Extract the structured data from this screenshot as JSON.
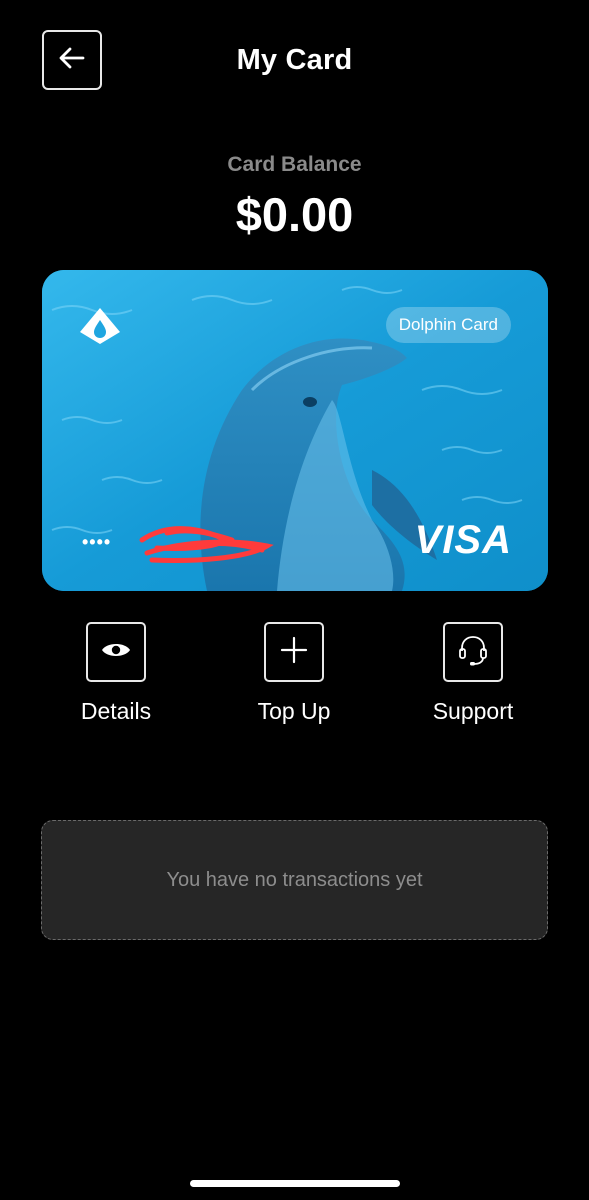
{
  "header": {
    "title": "My Card",
    "back_icon": "arrow-left-icon"
  },
  "balance": {
    "label": "Card Balance",
    "value": "$0.00"
  },
  "card": {
    "name": "Dolphin Card",
    "masked_number": "••••",
    "network": "VISA",
    "brand_logo_icon": "water-drop-logo-icon",
    "background_color": "#1fa6e0"
  },
  "actions": [
    {
      "label": "Details",
      "icon": "eye-icon"
    },
    {
      "label": "Top Up",
      "icon": "plus-icon"
    },
    {
      "label": "Support",
      "icon": "headset-icon"
    }
  ],
  "transactions": {
    "empty_message": "You have no transactions yet"
  }
}
